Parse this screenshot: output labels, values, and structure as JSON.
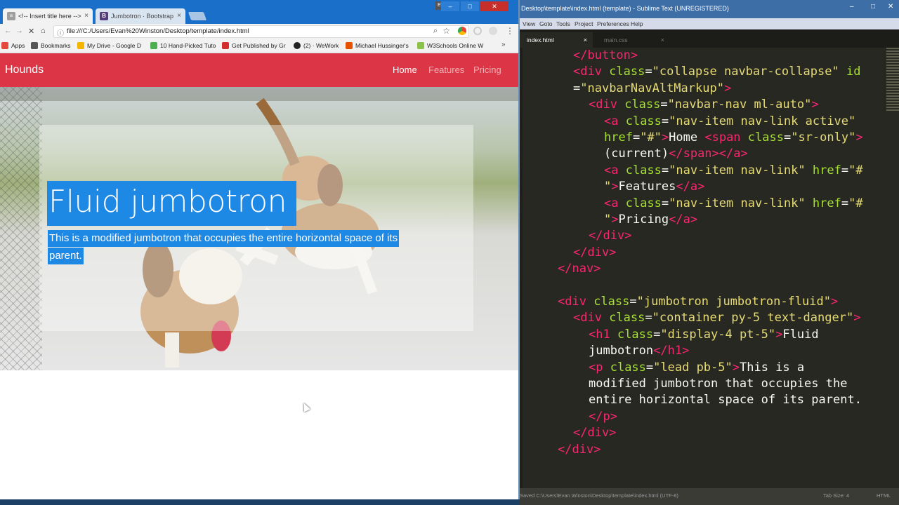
{
  "browser": {
    "tabs": [
      {
        "label": "<!-- Insert title here -->",
        "favicon": "doc-icon"
      },
      {
        "label": "Jumbotron · Bootstrap",
        "favicon": "B"
      }
    ],
    "close_glyph": "×",
    "user_label": "Evan",
    "window_buttons": {
      "minimize": "–",
      "maximize": "□",
      "close": "✕"
    },
    "url": "file:///C:/Users/Evan%20Winston/Desktop/template/index.html",
    "bookmarks": [
      {
        "label": "Apps",
        "color": "#e24a3b"
      },
      {
        "label": "Bookmarks",
        "color": "#555555"
      },
      {
        "label": "My Drive - Google D",
        "color": "#f4b400"
      },
      {
        "label": "10 Hand-Picked Tuto",
        "color": "#4caf50"
      },
      {
        "label": "Get Published by Gr",
        "color": "#d32f2f"
      },
      {
        "label": "(2) · WeWork",
        "color": "#222222"
      },
      {
        "label": "Michael Hussinger's",
        "color": "#e65100"
      },
      {
        "label": "W3Schools Online W",
        "color": "#8bc34a"
      }
    ],
    "bookmarks_more": "»"
  },
  "site": {
    "brand": "Hounds",
    "nav": [
      {
        "label": "Home",
        "active": true
      },
      {
        "label": "Features",
        "active": false
      },
      {
        "label": "Pricing",
        "active": false
      }
    ],
    "jumbotron": {
      "heading": "Fluid jumbotron",
      "lead_line1": "This is a modified jumbotron that occupies the entire horizontal space of its",
      "lead_line2": "parent."
    }
  },
  "editor": {
    "title": "Desktop\\template\\index.html (template) - Sublime Text (UNREGISTERED)",
    "menu": [
      "View",
      "Goto",
      "Tools",
      "Project",
      "Preferences",
      "Help"
    ],
    "tabs": [
      {
        "label": "index.html",
        "active": true
      },
      {
        "label": "main.css",
        "active": false
      }
    ],
    "status_left": "Saved C:\\Users\\Evan Winston\\Desktop\\template\\index.html (UTF-8)",
    "status_tab_size": "Tab Size: 4",
    "status_syntax": "HTML",
    "code_lines": [
      {
        "indent": 1,
        "tokens": [
          [
            "tg",
            "</button>"
          ]
        ]
      },
      {
        "indent": 1,
        "tokens": [
          [
            "tg",
            "<div "
          ],
          [
            "at",
            "class"
          ],
          [
            "pl",
            "="
          ],
          [
            "st",
            "\"collapse navbar-collapse\""
          ],
          [
            "pl",
            " "
          ],
          [
            "at",
            "id"
          ]
        ]
      },
      {
        "indent": 1,
        "tokens": [
          [
            "pl",
            "="
          ],
          [
            "st",
            "\"navbarNavAltMarkup\""
          ],
          [
            "tg",
            ">"
          ]
        ]
      },
      {
        "indent": 2,
        "tokens": [
          [
            "tg",
            "<div "
          ],
          [
            "at",
            "class"
          ],
          [
            "pl",
            "="
          ],
          [
            "st",
            "\"navbar-nav ml-auto\""
          ],
          [
            "tg",
            ">"
          ]
        ]
      },
      {
        "indent": 3,
        "tokens": [
          [
            "tg",
            "<a "
          ],
          [
            "at",
            "class"
          ],
          [
            "pl",
            "="
          ],
          [
            "st",
            "\"nav-item nav-link active\""
          ]
        ]
      },
      {
        "indent": 3,
        "tokens": [
          [
            "at",
            "href"
          ],
          [
            "pl",
            "="
          ],
          [
            "st",
            "\"#\""
          ],
          [
            "tg",
            ">"
          ],
          [
            "pl",
            "Home "
          ],
          [
            "tg",
            "<span "
          ],
          [
            "at",
            "class"
          ],
          [
            "pl",
            "="
          ],
          [
            "st",
            "\"sr-only\""
          ],
          [
            "tg",
            ">"
          ]
        ]
      },
      {
        "indent": 3,
        "tokens": [
          [
            "pl",
            "(current)"
          ],
          [
            "tg",
            "</span></a>"
          ]
        ]
      },
      {
        "indent": 3,
        "tokens": [
          [
            "tg",
            "<a "
          ],
          [
            "at",
            "class"
          ],
          [
            "pl",
            "="
          ],
          [
            "st",
            "\"nav-item nav-link\""
          ],
          [
            "pl",
            " "
          ],
          [
            "at",
            "href"
          ],
          [
            "pl",
            "="
          ],
          [
            "st",
            "\"#"
          ]
        ]
      },
      {
        "indent": 3,
        "tokens": [
          [
            "st",
            "\""
          ],
          [
            "tg",
            ">"
          ],
          [
            "pl",
            "Features"
          ],
          [
            "tg",
            "</a>"
          ]
        ]
      },
      {
        "indent": 3,
        "tokens": [
          [
            "tg",
            "<a "
          ],
          [
            "at",
            "class"
          ],
          [
            "pl",
            "="
          ],
          [
            "st",
            "\"nav-item nav-link\""
          ],
          [
            "pl",
            " "
          ],
          [
            "at",
            "href"
          ],
          [
            "pl",
            "="
          ],
          [
            "st",
            "\"#"
          ]
        ]
      },
      {
        "indent": 3,
        "tokens": [
          [
            "st",
            "\""
          ],
          [
            "tg",
            ">"
          ],
          [
            "pl",
            "Pricing"
          ],
          [
            "tg",
            "</a>"
          ]
        ]
      },
      {
        "indent": 2,
        "tokens": [
          [
            "tg",
            "</div>"
          ]
        ]
      },
      {
        "indent": 1,
        "tokens": [
          [
            "tg",
            "</div>"
          ]
        ]
      },
      {
        "indent": 0,
        "tokens": [
          [
            "tg",
            "</nav>"
          ]
        ]
      },
      {
        "indent": 0,
        "tokens": []
      },
      {
        "indent": 0,
        "tokens": [
          [
            "tg",
            "<div "
          ],
          [
            "at",
            "class"
          ],
          [
            "pl",
            "="
          ],
          [
            "st",
            "\"jumbotron jumbotron-fluid\""
          ],
          [
            "tg",
            ">"
          ]
        ]
      },
      {
        "indent": 1,
        "tokens": [
          [
            "tg",
            "<div "
          ],
          [
            "at",
            "class"
          ],
          [
            "pl",
            "="
          ],
          [
            "st",
            "\"container py-5 text-danger\""
          ],
          [
            "tg",
            ">"
          ]
        ]
      },
      {
        "indent": 2,
        "tokens": [
          [
            "tg",
            "<h1 "
          ],
          [
            "at",
            "class"
          ],
          [
            "pl",
            "="
          ],
          [
            "st",
            "\"display-4 pt-5\""
          ],
          [
            "tg",
            ">"
          ],
          [
            "pl",
            "Fluid"
          ]
        ]
      },
      {
        "indent": 2,
        "tokens": [
          [
            "pl",
            "jumbotron"
          ],
          [
            "tg",
            "</h1>"
          ]
        ]
      },
      {
        "indent": 2,
        "tokens": [
          [
            "tg",
            "<p "
          ],
          [
            "at",
            "class"
          ],
          [
            "pl",
            "="
          ],
          [
            "st",
            "\"lead pb-5\""
          ],
          [
            "tg",
            ">"
          ],
          [
            "pl",
            "This is a"
          ]
        ]
      },
      {
        "indent": 2,
        "tokens": [
          [
            "pl",
            "modified jumbotron that occupies the"
          ]
        ]
      },
      {
        "indent": 2,
        "tokens": [
          [
            "pl",
            "entire horizontal space of its parent."
          ]
        ]
      },
      {
        "indent": 2,
        "tokens": [
          [
            "tg",
            "</p>"
          ]
        ]
      },
      {
        "indent": 1,
        "tokens": [
          [
            "tg",
            "</div>"
          ]
        ]
      },
      {
        "indent": 0,
        "tokens": [
          [
            "tg",
            "</div>"
          ]
        ]
      }
    ]
  },
  "colors": {
    "navbar": "#dc3545",
    "selection": "#1e88e5",
    "editor_bg": "#272822",
    "tag": "#f92672",
    "attr": "#a6e22e",
    "string": "#e6db74"
  }
}
